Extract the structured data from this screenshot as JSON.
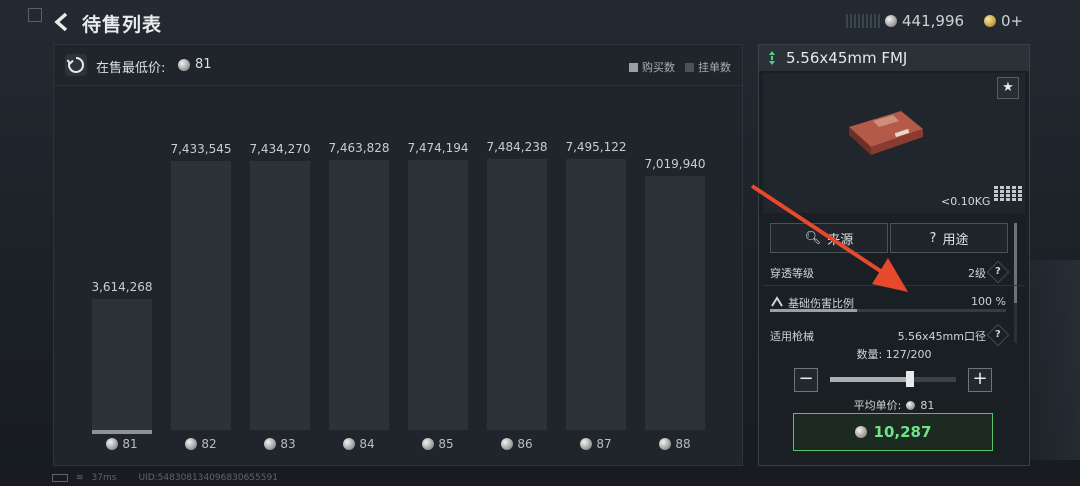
{
  "header": {
    "title": "待售列表",
    "silver_balance": "441,996",
    "gold_balance": "0+"
  },
  "chart_panel": {
    "lowest_price_label": "在售最低价:",
    "lowest_price_value": "81",
    "legend": [
      {
        "label": "购买数",
        "color": "#9a9fa3"
      },
      {
        "label": "挂单数",
        "color": "#4a5157"
      }
    ]
  },
  "chart_data": {
    "type": "bar",
    "categories": [
      "81",
      "82",
      "83",
      "84",
      "85",
      "86",
      "87",
      "88"
    ],
    "values": [
      3614268,
      7433545,
      7434270,
      7463828,
      7474194,
      7484238,
      7495122,
      7019940
    ],
    "value_labels": [
      "3,614,268",
      "7,433,545",
      "7,434,270",
      "7,463,828",
      "7,474,194",
      "7,484,238",
      "7,495,122",
      "7,019,940"
    ],
    "ylim": [
      0,
      8300000
    ]
  },
  "item": {
    "name": "5.56x45mm FMJ",
    "weight": "<0.10KG",
    "source_btn": "来源",
    "usage_btn": "用途",
    "stats": {
      "penetration_label": "穿透等级",
      "penetration_value": "2级",
      "damage_label": "基础伤害比例",
      "damage_value": "100 %",
      "damage_fraction": 0.37,
      "weapon_label": "适用枪械",
      "weapon_value": "5.56x45mm口径"
    },
    "quantity_label": "数量: 127/200",
    "quantity_fraction": 0.635,
    "avg_price_label": "平均单价:",
    "avg_price_value": "81",
    "total_price": "10,287"
  },
  "footer": {
    "ping": "37ms",
    "uid": "UID:548308134096830655591"
  }
}
